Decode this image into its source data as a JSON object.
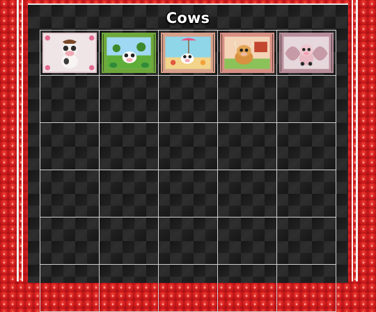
{
  "page": {
    "title": "Cows"
  },
  "gallery": {
    "rows": 6,
    "cols": 5,
    "thumbnails": [
      {
        "icon": "cow-with-bow-thumbnail",
        "bg": "#efe4e6",
        "frame": "#e3c9cf"
      },
      {
        "icon": "cow-in-meadow-thumbnail",
        "bg": "#8fd0f0",
        "frame": "#6ea83a"
      },
      {
        "icon": "cow-on-beach-thumbnail",
        "bg": "#9bdcea",
        "frame": "#d8a08a"
      },
      {
        "icon": "highland-calf-thumbnail",
        "bg": "#f1c7a8",
        "frame": "#d88f84"
      },
      {
        "icon": "pink-calf-thumbnail",
        "bg": "#e9dde2",
        "frame": "#b98e9b"
      }
    ]
  }
}
